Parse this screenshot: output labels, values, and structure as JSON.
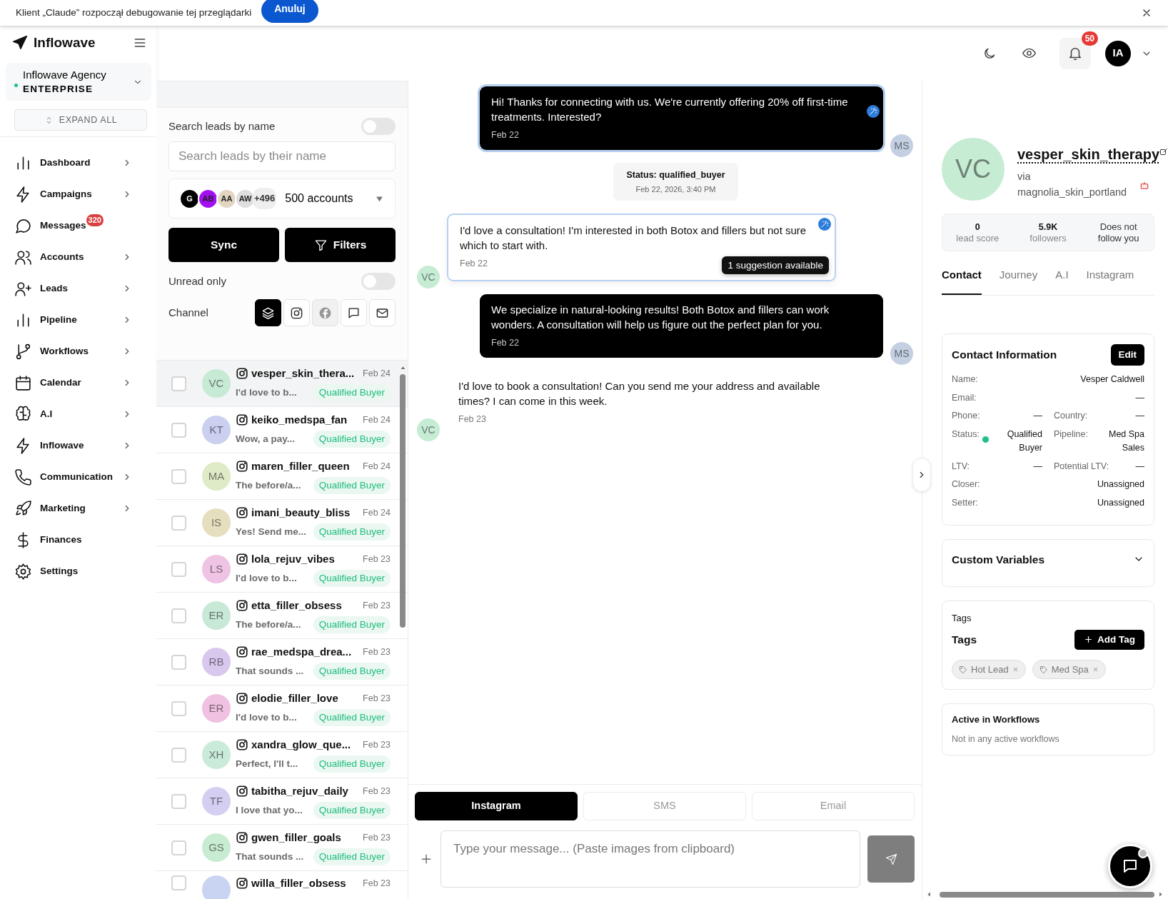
{
  "debug_bar": {
    "message": "Klient „Claude” rozpoczął debugowanie tej przeglądarki",
    "cancel_button": "Anuluj"
  },
  "sidebar": {
    "logo": "Inflowave",
    "workspace": {
      "name": "Inflowave Agency",
      "plan": "ENTERPRISE",
      "online": true
    },
    "expand_all": "EXPAND ALL",
    "items": [
      {
        "label": "Dashboard",
        "has_submenu": true
      },
      {
        "label": "Campaigns",
        "has_submenu": true
      },
      {
        "label": "Messages",
        "has_submenu": false,
        "badge": "320"
      },
      {
        "label": "Accounts",
        "has_submenu": true
      },
      {
        "label": "Leads",
        "has_submenu": true
      },
      {
        "label": "Pipeline",
        "has_submenu": true
      },
      {
        "label": "Workflows",
        "has_submenu": true
      },
      {
        "label": "Calendar",
        "has_submenu": true
      },
      {
        "label": "A.I",
        "has_submenu": true
      },
      {
        "label": "Inflowave",
        "has_submenu": true
      },
      {
        "label": "Communication",
        "has_submenu": true
      },
      {
        "label": "Marketing",
        "has_submenu": true
      },
      {
        "label": "Finances",
        "has_submenu": false
      },
      {
        "label": "Settings",
        "has_submenu": false
      }
    ]
  },
  "header": {
    "notifications_badge": "50",
    "user_initials": "IA"
  },
  "leads_panel": {
    "search_label": "Search leads by name",
    "search_toggle_on": false,
    "search": {
      "placeholder": "Search leads by their name"
    },
    "accounts": {
      "avatars": [
        {
          "initials": "G",
          "color": "#000000"
        },
        {
          "initials": "AB",
          "color": "#a40ff2"
        },
        {
          "initials": "AA",
          "color": "#e2d6c3"
        },
        {
          "initials": "AW",
          "color": "#dedede"
        }
      ],
      "more": "+496",
      "summary": "500 accounts"
    },
    "sync_button": "Sync",
    "filters_button": "Filters",
    "unread_label": "Unread only",
    "unread_on": false,
    "channel_label": "Channel",
    "channels": [
      {
        "selected": true,
        "disabled": false
      },
      {
        "selected": false,
        "disabled": false
      },
      {
        "selected": false,
        "disabled": true
      },
      {
        "selected": false,
        "disabled": false
      },
      {
        "selected": false,
        "disabled": false
      }
    ],
    "leads": [
      {
        "initials": "VC",
        "color": "#c6ead4",
        "name": "vesper_skin_thera...",
        "date": "Feb 24",
        "preview": "I'd love to b...",
        "status": "Qualified Buyer",
        "selected": true,
        "checked": false
      },
      {
        "initials": "KT",
        "color": "#cbcff0",
        "name": "keiko_medspa_fan",
        "date": "Feb 24",
        "preview": "Wow, a pay...",
        "status": "Qualified Buyer",
        "selected": false,
        "checked": false
      },
      {
        "initials": "MA",
        "color": "#dfeac6",
        "name": "maren_filler_queen",
        "date": "Feb 24",
        "preview": "The before/a...",
        "status": "Qualified Buyer",
        "selected": false,
        "checked": false
      },
      {
        "initials": "IS",
        "color": "#e6dfbf",
        "name": "imani_beauty_bliss",
        "date": "Feb 24",
        "preview": "Yes! Send me...",
        "status": "Qualified Buyer",
        "selected": false,
        "checked": false
      },
      {
        "initials": "LS",
        "color": "#efc3e3",
        "name": "lola_rejuv_vibes",
        "date": "Feb 23",
        "preview": "I'd love to b...",
        "status": "Qualified Buyer",
        "selected": false,
        "checked": false
      },
      {
        "initials": "ER",
        "color": "#c7e9d6",
        "name": "etta_filler_obsess",
        "date": "Feb 23",
        "preview": "The before/a...",
        "status": "Qualified Buyer",
        "selected": false,
        "checked": false
      },
      {
        "initials": "RB",
        "color": "#d8c8ee",
        "name": "rae_medspa_drea...",
        "date": "Feb 23",
        "preview": "That sounds ...",
        "status": "Qualified Buyer",
        "selected": false,
        "checked": false
      },
      {
        "initials": "ER",
        "color": "#f0c1e1",
        "name": "elodie_filler_love",
        "date": "Feb 23",
        "preview": "I'd love to b...",
        "status": "Qualified Buyer",
        "selected": false,
        "checked": false
      },
      {
        "initials": "XH",
        "color": "#caebd9",
        "name": "xandra_glow_que...",
        "date": "Feb 23",
        "preview": "Perfect, I'll t...",
        "status": "Qualified Buyer",
        "selected": false,
        "checked": false
      },
      {
        "initials": "TF",
        "color": "#d4cff1",
        "name": "tabitha_rejuv_daily",
        "date": "Feb 23",
        "preview": "I love that yo...",
        "status": "Qualified Buyer",
        "selected": false,
        "checked": false
      },
      {
        "initials": "GS",
        "color": "#c7ecd2",
        "name": "gwen_filler_goals",
        "date": "Feb 23",
        "preview": "That sounds ...",
        "status": "Qualified Buyer",
        "selected": false,
        "checked": false
      },
      {
        "color": "#c8d4f1",
        "name": "willa_filler_obsess",
        "date": "Feb 23",
        "selected": false,
        "checked": false
      }
    ]
  },
  "chat": {
    "messages": [
      {
        "kind": "outgoing",
        "text": "Hi! Thanks for connecting with us. We're currently offering 20% off first-time treatments. Interested?",
        "date": "Feb 22",
        "avatar": "MS",
        "highlighted": true
      },
      {
        "kind": "status",
        "text": "Status: qualified_buyer",
        "date": "Feb 22, 2026, 3:40 PM"
      },
      {
        "kind": "incoming",
        "text": "I'd love a consultation! I'm interested in both Botox and fillers but not sure which to start with.",
        "date": "Feb 22",
        "avatar": "VC",
        "highlighted": true,
        "suggestion": "1 suggestion available"
      },
      {
        "kind": "outgoing",
        "text": "We specialize in natural-looking results! Both Botox and fillers can work wonders. A consultation will help us figure out the perfect plan for you.",
        "date": "Feb 22",
        "avatar": "MS",
        "highlighted": false
      },
      {
        "kind": "incoming",
        "text": "I'd love to book a consultation! Can you send me your address and available times? I can come in this week.",
        "date": "Feb 23",
        "avatar": "VC",
        "highlighted": false
      }
    ],
    "composer": {
      "tabs": [
        {
          "label": "Instagram",
          "selected": true
        },
        {
          "label": "SMS",
          "selected": false
        },
        {
          "label": "Email",
          "selected": false
        }
      ],
      "placeholder": "Type your message... (Paste images from clipboard)",
      "send_disabled": true
    }
  },
  "contact": {
    "avatar": "VC",
    "username": "vesper_skin_therapy",
    "via": "via",
    "source": "magnolia_skin_portland",
    "stats": [
      {
        "kind": "number",
        "value": "0",
        "label": "lead score"
      },
      {
        "kind": "number",
        "value": "5.9K",
        "label": "followers"
      },
      {
        "kind": "note",
        "value": "Does not follow you"
      }
    ],
    "tabs": [
      {
        "label": "Contact",
        "selected": true
      },
      {
        "label": "Journey",
        "selected": false
      },
      {
        "label": "A.I",
        "selected": false
      },
      {
        "label": "Instagram",
        "selected": false
      }
    ],
    "info": {
      "title": "Contact Information",
      "edit_button": "Edit",
      "rows": [
        [
          {
            "label": "Name:",
            "value": "Vesper Caldwell"
          }
        ],
        [
          {
            "label": "Email:",
            "value": "—"
          }
        ],
        [
          {
            "label": "Phone:",
            "value": "—"
          },
          {
            "label": "Country:",
            "value": "—"
          }
        ],
        [
          {
            "label": "Status:",
            "value": "Qualified Buyer",
            "color": "#1fbf8a"
          },
          {
            "label": "Pipeline:",
            "value": "Med Spa Sales"
          }
        ],
        [
          {
            "label": "LTV:",
            "value": "—"
          },
          {
            "label": "Potential LTV:",
            "value": "—"
          }
        ],
        [
          {
            "label": "Closer:",
            "value": "Unassigned"
          }
        ],
        [
          {
            "label": "Setter:",
            "value": "Unassigned"
          }
        ]
      ]
    },
    "custom_variables": {
      "title": "Custom Variables",
      "expanded": false
    },
    "tags": {
      "section_label": "Tags",
      "title": "Tags",
      "add_button": "Add Tag",
      "items": [
        "Hot Lead",
        "Med Spa"
      ]
    },
    "workflows": {
      "title": "Active in Workflows",
      "empty": "Not in any active workflows"
    }
  }
}
